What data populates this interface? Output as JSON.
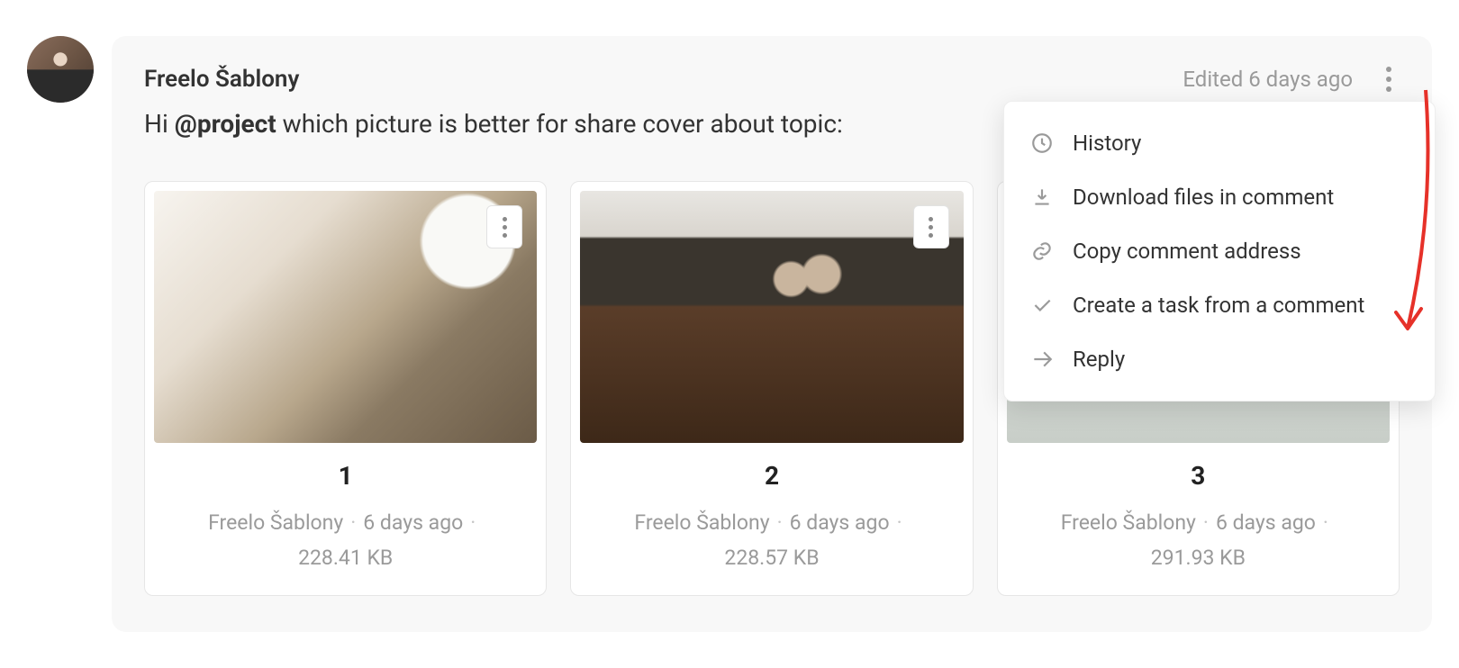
{
  "comment": {
    "author": "Freelo Šablony",
    "edited_label": "Edited 6 days ago",
    "text_prefix": "Hi ",
    "mention": "@project",
    "text_suffix": " which picture is better for share cover about topic:"
  },
  "dropdown": {
    "items": [
      {
        "label": "History"
      },
      {
        "label": "Download files in comment"
      },
      {
        "label": "Copy comment address"
      },
      {
        "label": "Create a task from a comment"
      },
      {
        "label": "Reply"
      }
    ]
  },
  "attachments": [
    {
      "title": "1",
      "author": "Freelo Šablony",
      "time": "6 days ago",
      "size": "228.41 KB"
    },
    {
      "title": "2",
      "author": "Freelo Šablony",
      "time": "6 days ago",
      "size": "228.57 KB"
    },
    {
      "title": "3",
      "author": "Freelo Šablony",
      "time": "6 days ago",
      "size": "291.93 KB"
    }
  ]
}
